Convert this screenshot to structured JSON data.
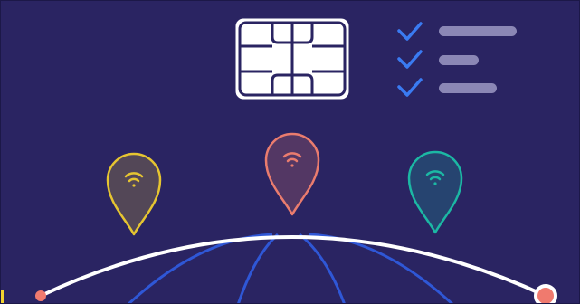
{
  "illustration": {
    "subject_icons": [
      "sim-card-icon",
      "checklist-icon",
      "location-pin-wifi-icon",
      "globe-icon"
    ],
    "colors": {
      "background": "#2a2462",
      "sim_card": "#ffffff",
      "sim_card_outline": "#2a2462",
      "checkmark": "#3a7bf2",
      "checklist_bar": "#8b87b5",
      "pin_left": "#e6c531",
      "pin_center": "#ea7c6e",
      "pin_right": "#1cb8a4",
      "globe_arc": "#ffffff",
      "globe_grid": "#2f57d6",
      "arc_end_dot": "#f07a6e"
    },
    "checklist": {
      "rows": 3,
      "bar_fractions": [
        1.0,
        0.5,
        0.75
      ]
    },
    "pins": [
      {
        "name": "left",
        "color_key": "pin_left"
      },
      {
        "name": "center",
        "color_key": "pin_center"
      },
      {
        "name": "right",
        "color_key": "pin_right"
      }
    ]
  }
}
